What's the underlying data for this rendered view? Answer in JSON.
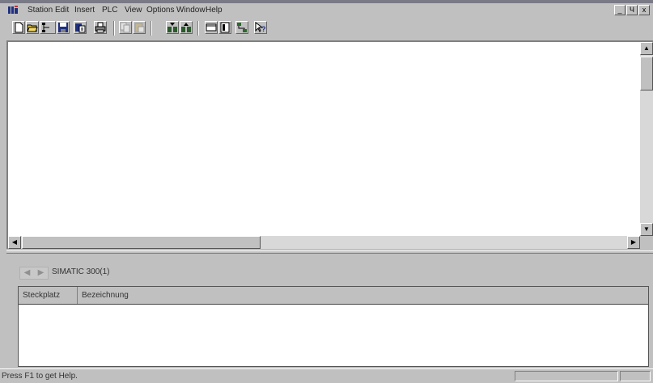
{
  "menubar": {
    "items": [
      "Station",
      "Edit",
      "Insert",
      "PLC",
      "View",
      "Options",
      "Window",
      "Help"
    ]
  },
  "window_controls": [
    "_",
    "Ч",
    "x"
  ],
  "toolbar": {
    "buttons": [
      {
        "name": "new-icon"
      },
      {
        "name": "open-icon"
      },
      {
        "name": "accessible-nodes-icon"
      },
      {
        "name": "save-icon"
      },
      {
        "name": "save-compile-icon"
      },
      {
        "name": "print-icon"
      },
      {
        "name": "copy-icon"
      },
      {
        "name": "paste-icon"
      },
      {
        "name": "download-icon"
      },
      {
        "name": "upload-icon"
      },
      {
        "name": "catalog-icon"
      },
      {
        "name": "properties-icon"
      },
      {
        "name": "network-icon"
      },
      {
        "name": "context-help-icon"
      }
    ]
  },
  "lower_panel": {
    "rack_title": "SIMATIC 300(1)",
    "columns": [
      "Steckplatz",
      "Bezeichnung"
    ]
  },
  "statusbar": {
    "text": "Press F1 to get Help."
  },
  "colors": {
    "face": "#c0c0c0",
    "workspace": "#ffffff",
    "shadow": "#808080"
  }
}
